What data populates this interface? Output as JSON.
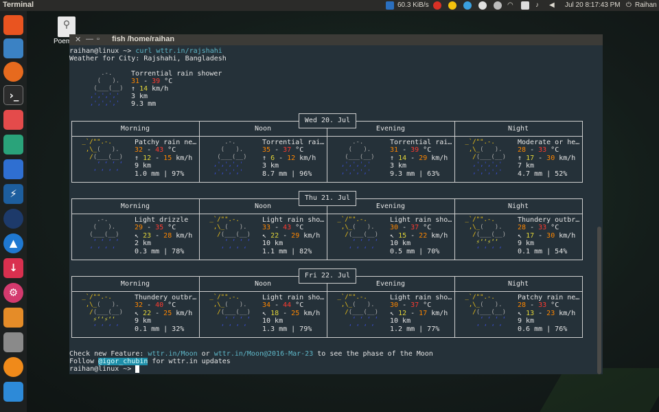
{
  "topbar": {
    "app_name": "Terminal",
    "net_speed": "60.3 KiB/s",
    "datetime": "Jul 20  8:17:43 PM",
    "user": "Raihan"
  },
  "desktop": {
    "file_label": "Poem"
  },
  "window": {
    "title": "fish  /home/raihan"
  },
  "terminal": {
    "prompt": "raihan@linux ~> ",
    "command": "curl wttr.in/rajshahi",
    "weather_for": "Weather for City: Rajshahi, Bangladesh",
    "current": {
      "condition": "Torrential rain shower",
      "temp_lo": "31",
      "temp_hi": "39",
      "temp_unit": " °C",
      "wind_arrow": "↑",
      "wind": "14",
      "wind_unit": " km/h",
      "visibility": "3 km",
      "precip": "9.3 mm"
    },
    "phases": [
      "Morning",
      "Noon",
      "Evening",
      "Night"
    ],
    "days": [
      {
        "label": "Wed 20. Jul",
        "cells": [
          {
            "cond": "Patchy rain ne…",
            "t1": "32",
            "t2": "43",
            "arrow": "↑",
            "w1": "12",
            "w2": "15",
            "vis": "9 km",
            "precip": "1.0 mm | 97%",
            "icon": "sunrain"
          },
          {
            "cond": "Torrential rai…",
            "t1": "35",
            "t2": "37",
            "arrow": "↑",
            "w1": "6",
            "w2": "12",
            "vis": "3 km",
            "precip": "8.7 mm | 96%",
            "icon": "heavyrain"
          },
          {
            "cond": "Torrential rai…",
            "t1": "31",
            "t2": "39",
            "arrow": "↑",
            "w1": "14",
            "w2": "29",
            "vis": "3 km",
            "precip": "9.3 mm | 63%",
            "icon": "heavyrain"
          },
          {
            "cond": "Moderate or he…",
            "t1": "28",
            "t2": "33",
            "arrow": "↑",
            "w1": "17",
            "w2": "30",
            "vis": "7 km",
            "precip": "4.7 mm | 52%",
            "icon": "heavysun"
          }
        ]
      },
      {
        "label": "Thu 21. Jul",
        "cells": [
          {
            "cond": "Light drizzle",
            "t1": "29",
            "t2": "35",
            "arrow": "↖",
            "w1": "23",
            "w2": "28",
            "vis": "2 km",
            "precip": "0.3 mm | 78%",
            "icon": "drizzle"
          },
          {
            "cond": "Light rain sho…",
            "t1": "33",
            "t2": "43",
            "arrow": "↖",
            "w1": "22",
            "w2": "29",
            "vis": "10 km",
            "precip": "1.1 mm | 82%",
            "icon": "sunrain"
          },
          {
            "cond": "Light rain sho…",
            "t1": "30",
            "t2": "37",
            "arrow": "↖",
            "w1": "15",
            "w2": "22",
            "vis": "10 km",
            "precip": "0.5 mm | 70%",
            "icon": "sunrain"
          },
          {
            "cond": "Thundery outbr…",
            "t1": "28",
            "t2": "33",
            "arrow": "↖",
            "w1": "17",
            "w2": "30",
            "vis": "9 km",
            "precip": "0.1 mm | 54%",
            "icon": "thunder"
          }
        ]
      },
      {
        "label": "Fri 22. Jul",
        "cells": [
          {
            "cond": "Thundery outbr…",
            "t1": "32",
            "t2": "40",
            "arrow": "↖",
            "w1": "22",
            "w2": "25",
            "vis": "9 km",
            "precip": "0.1 mm | 32%",
            "icon": "thunder"
          },
          {
            "cond": "Light rain sho…",
            "t1": "34",
            "t2": "44",
            "arrow": "↖",
            "w1": "18",
            "w2": "25",
            "vis": "10 km",
            "precip": "1.3 mm | 79%",
            "icon": "sunrain"
          },
          {
            "cond": "Light rain sho…",
            "t1": "30",
            "t2": "37",
            "arrow": "↖",
            "w1": "12",
            "w2": "17",
            "vis": "10 km",
            "precip": "1.2 mm | 77%",
            "icon": "sunrain"
          },
          {
            "cond": "Patchy rain ne…",
            "t1": "28",
            "t2": "33",
            "arrow": "↖",
            "w1": "13",
            "w2": "23",
            "vis": "9 km",
            "precip": "0.6 mm | 76%",
            "icon": "sunrain"
          }
        ]
      }
    ],
    "footer1_pre": "Check new Feature: ",
    "footer1_link1": "wttr.in/Moon",
    "footer1_mid": " or ",
    "footer1_link2": "wttr.in/Moon@2016-Mar-23",
    "footer1_post": " to see the phase of the Moon",
    "footer2_pre": "Follow ",
    "footer2_handle": "@igor_chubin",
    "footer2_post": " for wttr.in updates",
    "prompt2": "raihan@linux ~> "
  },
  "colors": {
    "terminal_bg": "#253139",
    "accent_link": "#5fb8c9",
    "temp_warm": "#ff8700",
    "temp_hot": "#ff3b30",
    "wind": "#e3d63a"
  }
}
